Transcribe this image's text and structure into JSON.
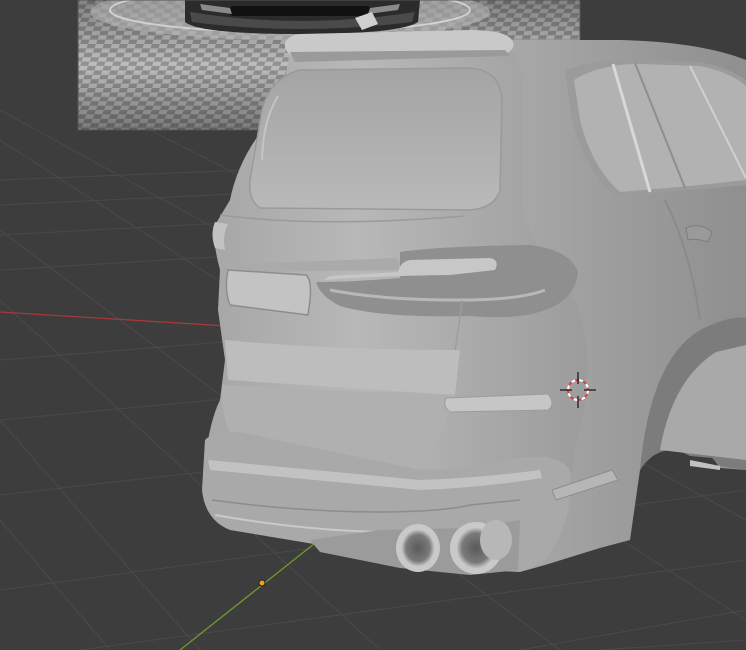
{
  "viewport": {
    "background": "#3d3d3d",
    "grid_color": "#4a4a4a",
    "axis_x_color": "#a33a3a",
    "axis_y_color": "#6e9a2c",
    "origin_color": "#f2a01c"
  },
  "reference_image": {
    "icon": "checker-floor-reference-image"
  },
  "model": {
    "icon": "suv-rear-model",
    "shading": "solid",
    "base_color": "#b4b4b4"
  },
  "cursor_3d": {
    "icon": "3d-cursor-icon",
    "ring_colors": [
      "#e23b3b",
      "#ffffff"
    ]
  }
}
